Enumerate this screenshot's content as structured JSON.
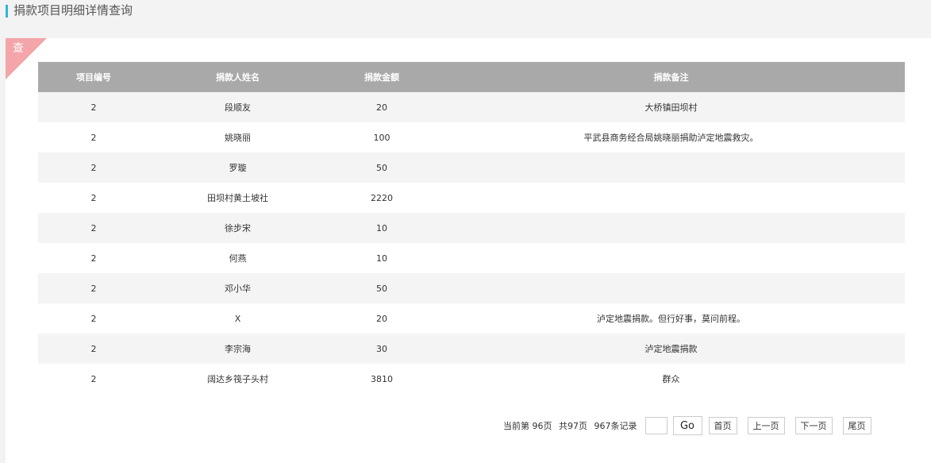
{
  "header": {
    "title": "捐款项目明细详情查询",
    "accent_color": "#2bb7d6"
  },
  "panel": {
    "corner_label": "查",
    "corner_color": "#f3a5a9"
  },
  "table": {
    "columns": [
      "项目编号",
      "捐款人姓名",
      "捐款金额",
      "捐款备注"
    ],
    "rows": [
      [
        "2",
        "段顺友",
        "20",
        "大桥镇田坝村"
      ],
      [
        "2",
        "姚晓丽",
        "100",
        "平武县商务经合局姚晓丽捐助泸定地震救灾。"
      ],
      [
        "2",
        "罗璇",
        "50",
        ""
      ],
      [
        "2",
        "田坝村黄土坡社",
        "2220",
        ""
      ],
      [
        "2",
        "徐步宋",
        "10",
        ""
      ],
      [
        "2",
        "何燕",
        "10",
        ""
      ],
      [
        "2",
        "邓小华",
        "50",
        ""
      ],
      [
        "2",
        "X",
        "20",
        "泸定地震捐款。但行好事，莫问前程。"
      ],
      [
        "2",
        "李宗海",
        "30",
        "泸定地震捐款"
      ],
      [
        "2",
        "阔达乡筏子头村",
        "3810",
        "群众"
      ]
    ]
  },
  "pager": {
    "current_page": "当前第  96页",
    "total_pages": "共97页",
    "total_records": "967条记录",
    "input_value": "",
    "go_label": "Go",
    "first_label": "首页",
    "prev_label": "上一页",
    "next_label": "下一页",
    "last_label": "尾页"
  }
}
